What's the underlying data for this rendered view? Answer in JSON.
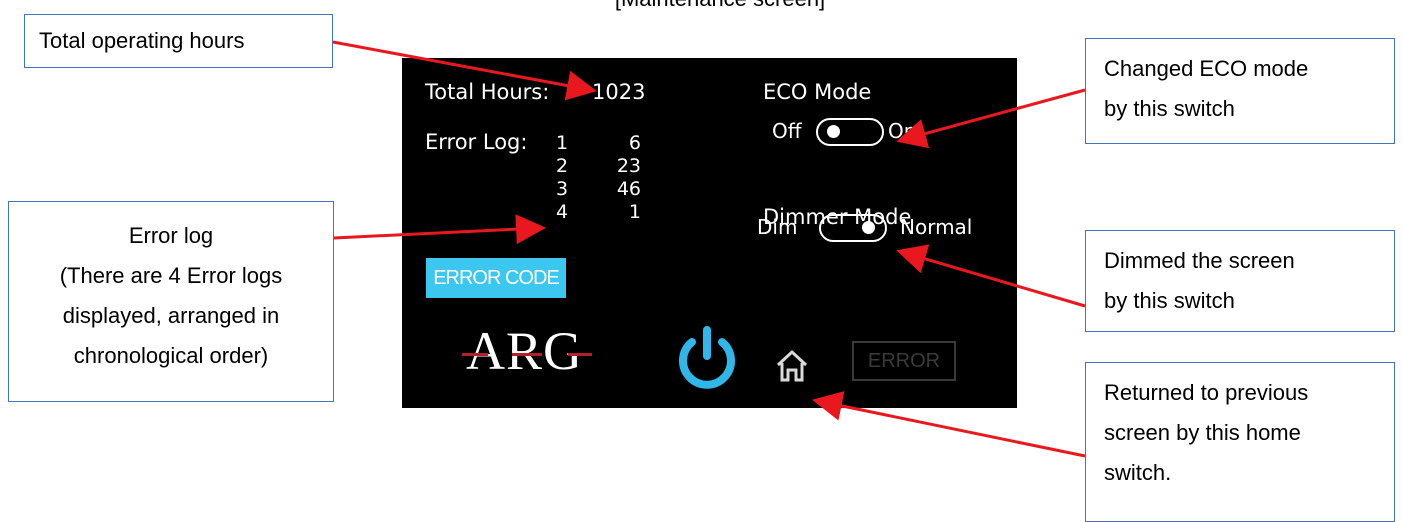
{
  "caption": "[Maintenance screen]",
  "callouts": {
    "total_hours": [
      "Total operating hours"
    ],
    "error_log": [
      "Error log",
      "(There are 4 Error logs",
      "displayed, arranged in",
      "chronological order)"
    ],
    "eco": [
      "Changed ECO mode",
      "by this switch"
    ],
    "dim": [
      "Dimmed the screen",
      "by this switch"
    ],
    "home": [
      "Returned to previous",
      "screen by this home",
      "switch."
    ]
  },
  "screen": {
    "total_hours_label": "Total Hours:",
    "total_hours_value": "1023",
    "error_log_label": "Error Log:",
    "error_log": [
      {
        "index": "1",
        "count": "6"
      },
      {
        "index": "2",
        "count": "23"
      },
      {
        "index": "3",
        "count": "46"
      },
      {
        "index": "4",
        "count": "1"
      }
    ],
    "eco_label": "ECO Mode",
    "eco_off": "Off",
    "eco_on": "On",
    "eco_state": "off",
    "dimmer_label": "Dimmer Mode",
    "dimmer_dim": "Dim",
    "dimmer_normal": "Normal",
    "dimmer_state": "normal",
    "error_code_button": "ERROR CODE",
    "logo": "ARG",
    "error_button": "ERROR",
    "power_icon": "power-icon",
    "home_icon": "home-icon"
  },
  "colors": {
    "callout_border": "#4472c4",
    "arrow": "#e8181e",
    "power": "#2fb7ea",
    "error_code_bg": "#3cc7f0",
    "logo_line": "#b3202a"
  }
}
